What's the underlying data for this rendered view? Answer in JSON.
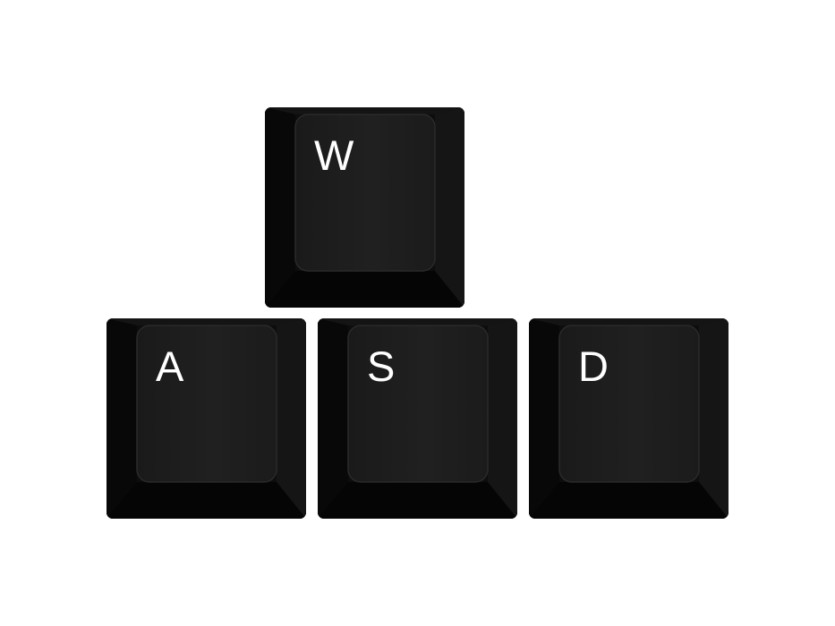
{
  "keys": [
    {
      "id": "w",
      "label": "W"
    },
    {
      "id": "a",
      "label": "A"
    },
    {
      "id": "s",
      "label": "S"
    },
    {
      "id": "d",
      "label": "D"
    }
  ],
  "colors": {
    "background": "#ffffff",
    "keycap": "#0c0c0c",
    "legend": "#ffffff"
  }
}
